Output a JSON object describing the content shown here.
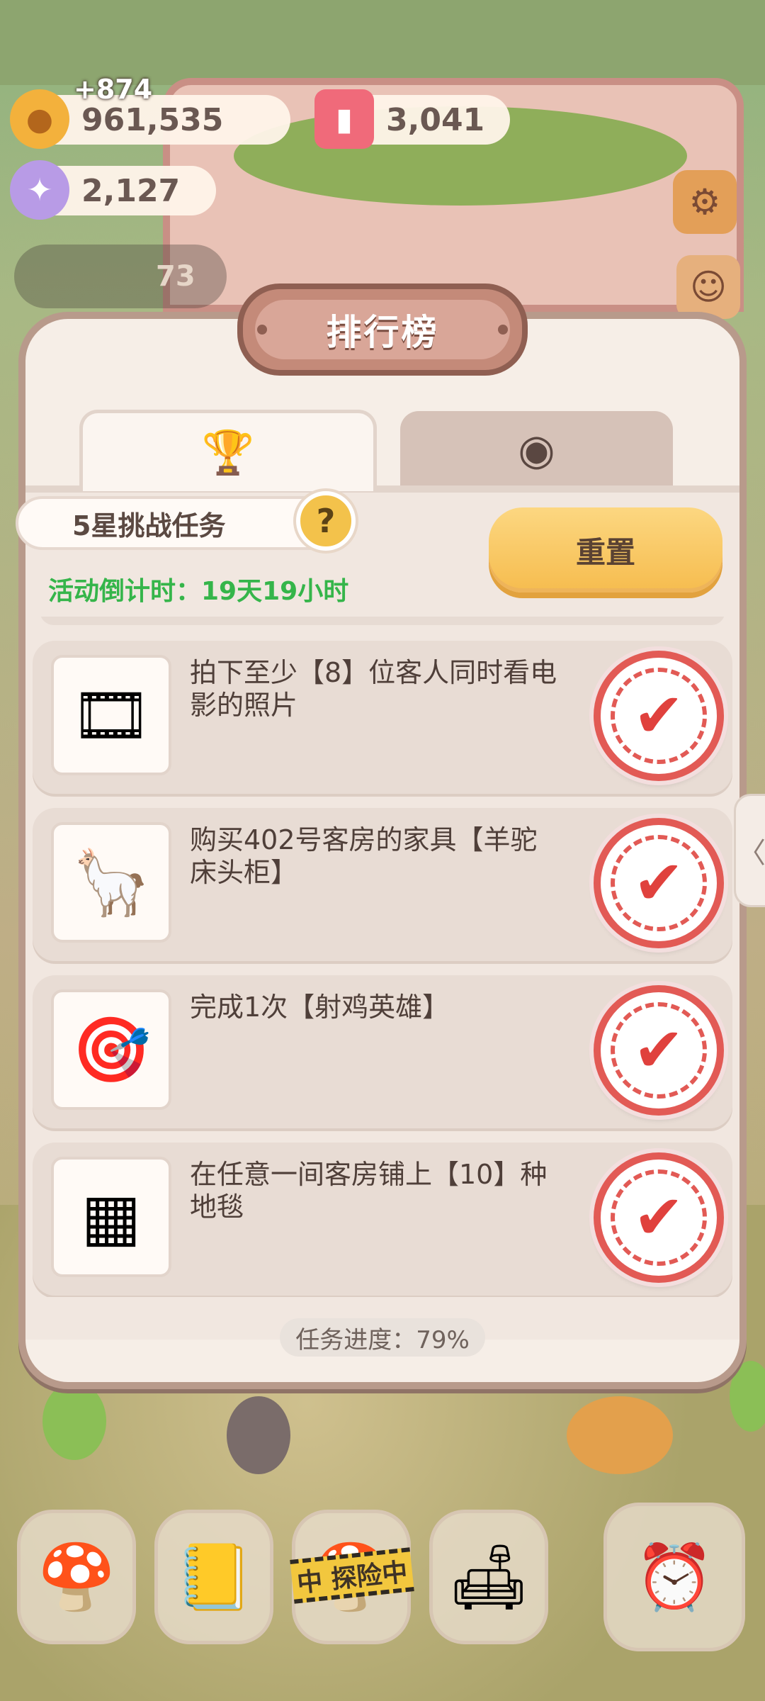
{
  "resources": {
    "coins": {
      "icon": "cookie-coin-icon",
      "value": "961,535",
      "gain": "+874"
    },
    "candles": {
      "icon": "pink-candle-icon",
      "value": "3,041"
    },
    "candy": {
      "icon": "candy-icon",
      "value": "2,127"
    },
    "dim_counter": {
      "value": "73"
    }
  },
  "modal": {
    "title": "排行榜",
    "tabs": [
      {
        "icon": "trophy-icon",
        "active": true
      },
      {
        "icon": "mushroom-icon",
        "active": false
      }
    ],
    "task_header": {
      "label": "5星挑战任务",
      "help": "?"
    },
    "countdown": "活动倒计时：19天19小时",
    "reset_button": "重置",
    "tasks": [
      {
        "icon": "film-camera-icon",
        "text": "拍下至少【8】位客人同时看电影的照片",
        "status": "completed-stamp"
      },
      {
        "icon": "alpaca-cabinet-icon",
        "text": "购买402号客房的家具【羊驼床头柜】",
        "status": "completed-stamp"
      },
      {
        "icon": "shooting-game-icon",
        "text": "完成1次【射鸡英雄】",
        "status": "completed-stamp"
      },
      {
        "icon": "carpet-icon",
        "text": "在任意一间客房铺上【10】种地毯",
        "status": "completed-stamp"
      }
    ],
    "progress": "任务进度：79%",
    "progress_value": 79
  },
  "bottom_nav": {
    "items": [
      {
        "icon": "mushroom-house-icon"
      },
      {
        "icon": "notebook-icon"
      },
      {
        "icon": "adventure-icon",
        "badge": "中 探险中"
      },
      {
        "icon": "shop-icon"
      },
      {
        "icon": "fish-alarm-icon"
      }
    ]
  },
  "colors": {
    "accent": "#f6bc4e",
    "countdown": "#35b54a",
    "stamp": "#e25a55",
    "panel": "#f6eee7"
  }
}
